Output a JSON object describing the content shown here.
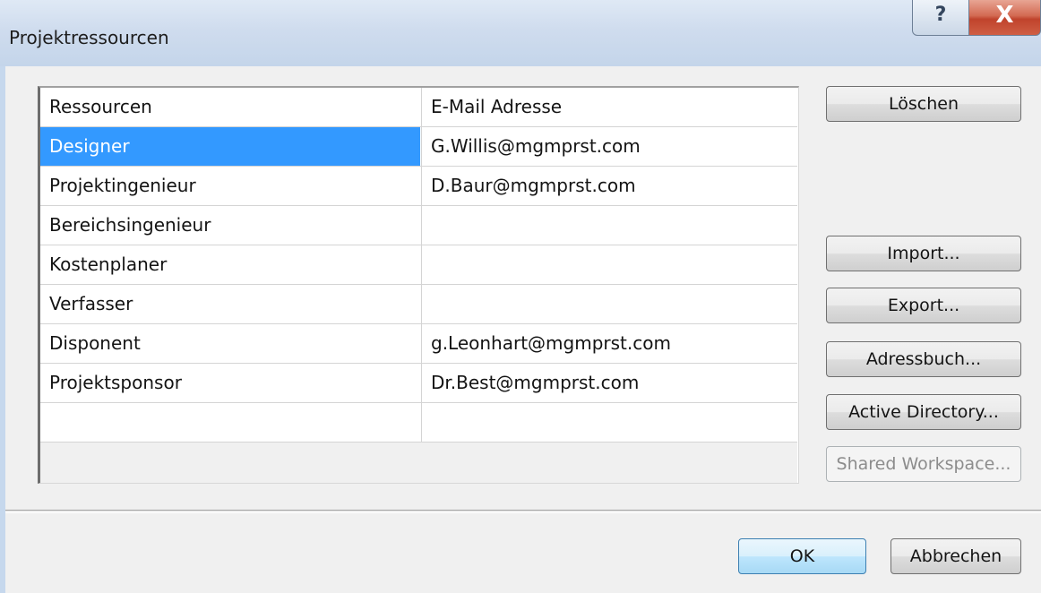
{
  "window": {
    "title": "Projektressourcen",
    "help_glyph": "?",
    "close_glyph": "X"
  },
  "table": {
    "headers": [
      "Ressourcen",
      "E-Mail Adresse"
    ],
    "rows": [
      {
        "resource": "Designer",
        "email": "G.Willis@mgmprst.com",
        "selected": true
      },
      {
        "resource": "Projektingenieur",
        "email": "D.Baur@mgmprst.com"
      },
      {
        "resource": "Bereichsingenieur",
        "email": ""
      },
      {
        "resource": "Kostenplaner",
        "email": ""
      },
      {
        "resource": "Verfasser",
        "email": ""
      },
      {
        "resource": "Disponent",
        "email": "g.Leonhart@mgmprst.com"
      },
      {
        "resource": "Projektsponsor",
        "email": "Dr.Best@mgmprst.com"
      },
      {
        "resource": "",
        "email": ""
      }
    ]
  },
  "buttons": {
    "delete": "Löschen",
    "import": "Import...",
    "export": "Export...",
    "addressbook": "Adressbuch...",
    "active_directory": "Active Directory...",
    "shared_workspace": "Shared Workspace...",
    "ok": "OK",
    "cancel": "Abbrechen"
  },
  "colors": {
    "selection": "#3399ff",
    "close_button": "#c0432c"
  }
}
